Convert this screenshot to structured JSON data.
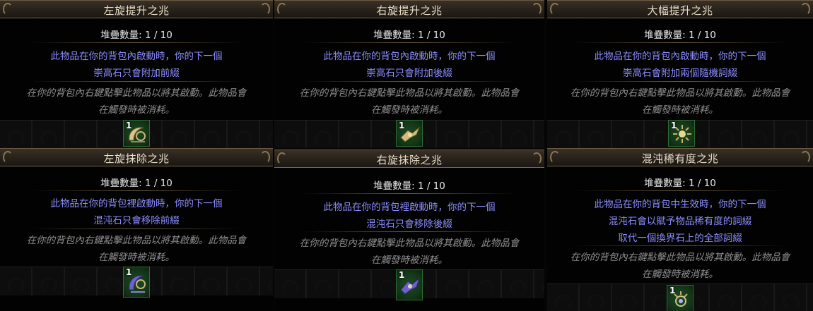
{
  "cards": [
    {
      "title": "左旋提升之兆",
      "stack": "堆疊數量: 1 / 10",
      "desc": [
        "此物品在你的背包內啟動時，你的下一個",
        "崇高石只會附加前綴"
      ],
      "flavor": [
        "在你的背包內右鍵點擊此物品以將其啟動。此物品會",
        "在觸發時被消耗。"
      ],
      "quantity": "1",
      "icon": "omen-crescent-icon"
    },
    {
      "title": "右旋提升之兆",
      "stack": "堆疊數量: 1 / 10",
      "desc": [
        "此物品在你的背包內啟動時，你的下一個",
        "崇高石只會附加後綴"
      ],
      "flavor": [
        "在你的背包內右鍵點擊此物品以將其啟動。此物品會",
        "在觸發時被消耗。"
      ],
      "quantity": "1",
      "icon": "omen-winged-icon"
    },
    {
      "title": "大幅提升之兆",
      "stack": "堆疊數量: 1 / 10",
      "desc": [
        "此物品在你的背包內啟動時，你的下一個",
        "崇高石會附加兩個隨機詞綴"
      ],
      "flavor": [
        "在你的背包內右鍵點擊此物品以將其啟動。此物品會",
        "在觸發時被消耗。"
      ],
      "quantity": "1",
      "icon": "omen-sun-icon"
    },
    {
      "title": "左旋抹除之兆",
      "stack": "堆疊數量: 1 / 10",
      "desc": [
        "此物品在你的背包裡啟動時，你的下一個",
        "混沌石只會移除前綴"
      ],
      "flavor": [
        "在你的背包內右鍵點擊此物品以將其啟動。此物品會",
        "在觸發時被消耗。"
      ],
      "quantity": "1",
      "icon": "omen-crescent-violet-icon"
    },
    {
      "title": "右旋抹除之兆",
      "stack": "堆疊數量: 1 / 10",
      "desc": [
        "此物品在你的背包裡啟動時，你的下一個",
        "混沌石只會移除後綴"
      ],
      "flavor": [
        "在你的背包內右鍵點擊此物品以將其啟動。此物品會",
        "在觸發時被消耗。"
      ],
      "quantity": "1",
      "icon": "omen-winged-violet-icon"
    },
    {
      "title": "混沌稀有度之兆",
      "stack": "堆疊數量: 1 / 10",
      "desc": [
        "此物品在你的背包中生效時，你的下一個",
        "混沌石會以賦予物品稀有度的詞綴",
        "取代一個換界石上的全部詞綴"
      ],
      "flavor": [
        "在你的背包內右鍵點擊此物品以將其啟動。此物品會",
        "在觸發時被消耗。"
      ],
      "quantity": "1",
      "icon": "omen-eye-icon"
    }
  ],
  "colors": {
    "magic_text": "#8c8cff",
    "flavor_text": "#8f8f8f",
    "title_text": "#e8dcc6",
    "slot_fill": "#1d4b22"
  }
}
